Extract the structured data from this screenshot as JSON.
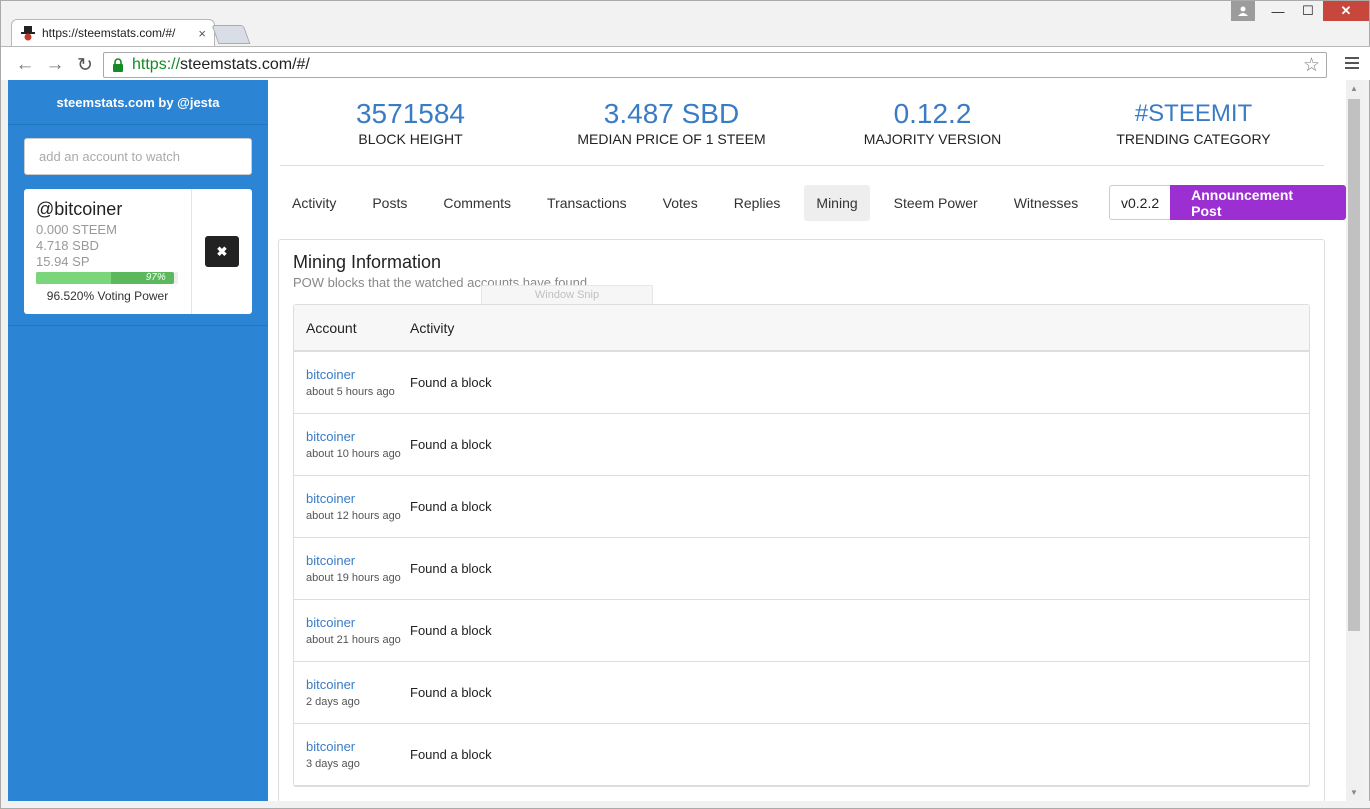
{
  "browser": {
    "tab_title": "https://steemstats.com/#/",
    "tab_close": "×",
    "url_scheme": "https://",
    "url_rest": "steemstats.com/#/",
    "back": "←",
    "forward": "→",
    "reload": "↻",
    "star": "☆",
    "min": "—",
    "max": "☐",
    "close": "✕"
  },
  "sidebar": {
    "brand": "steemstats.com by @jesta",
    "watch_placeholder": "add an account to watch",
    "account": {
      "name": "@bitcoiner",
      "steem": "0.000 STEEM",
      "sbd": "4.718 SBD",
      "sp": "15.94 SP",
      "voting_bar_pct": "97%",
      "voting_power_fraction": 0.97,
      "voting_power_label": "96.520% Voting Power",
      "remove": "✖"
    }
  },
  "stats": [
    {
      "value": "3571584",
      "label": "BLOCK HEIGHT"
    },
    {
      "value": "3.487 SBD",
      "label": "MEDIAN PRICE OF 1 STEEM"
    },
    {
      "value": "0.12.2",
      "label": "MAJORITY VERSION"
    },
    {
      "value": "#STEEMIT",
      "label": "TRENDING CATEGORY"
    }
  ],
  "tabs": [
    "Activity",
    "Posts",
    "Comments",
    "Transactions",
    "Votes",
    "Replies",
    "Mining",
    "Steem Power",
    "Witnesses"
  ],
  "active_tab": "Mining",
  "version": "v0.2.2",
  "announcement": "Announcement Post",
  "panel": {
    "title": "Mining Information",
    "subtitle": "POW blocks that the watched accounts have found.",
    "overlay": "Window Snip",
    "columns": [
      "Account",
      "Activity"
    ],
    "rows": [
      {
        "account": "bitcoiner",
        "time": "about 5 hours ago",
        "activity": "Found a block"
      },
      {
        "account": "bitcoiner",
        "time": "about 10 hours ago",
        "activity": "Found a block"
      },
      {
        "account": "bitcoiner",
        "time": "about 12 hours ago",
        "activity": "Found a block"
      },
      {
        "account": "bitcoiner",
        "time": "about 19 hours ago",
        "activity": "Found a block"
      },
      {
        "account": "bitcoiner",
        "time": "about 21 hours ago",
        "activity": "Found a block"
      },
      {
        "account": "bitcoiner",
        "time": "2 days ago",
        "activity": "Found a block"
      },
      {
        "account": "bitcoiner",
        "time": "3 days ago",
        "activity": "Found a block"
      }
    ]
  },
  "colors": {
    "sidebar": "#2b84d4",
    "accent": "#3a7cc4",
    "announce": "#9c2fd1",
    "voting": "#5cb85c"
  }
}
